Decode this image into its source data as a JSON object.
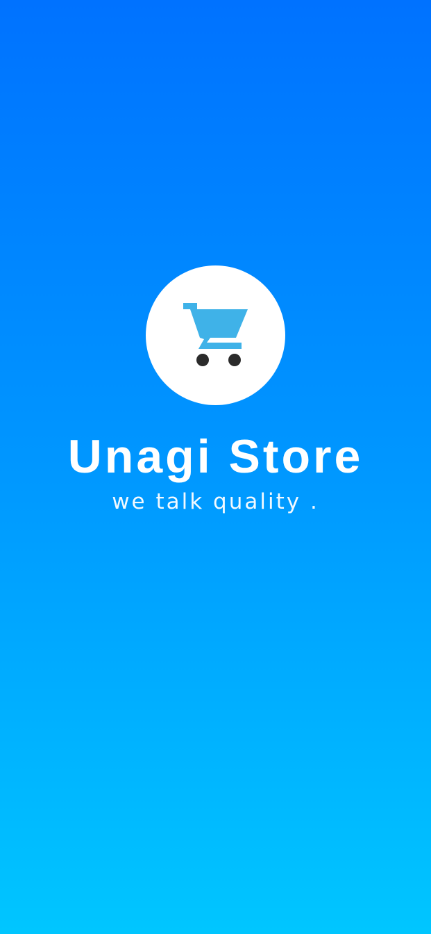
{
  "app": {
    "title": "Unagi Store",
    "tagline": "we talk quality ."
  },
  "logo": {
    "icon": "shopping-cart-icon",
    "cart_color": "#3FB2E8",
    "wheel_color": "#2B2B2B",
    "circle_color": "#FFFFFF"
  },
  "theme": {
    "gradient_top": "#0072FF",
    "gradient_bottom": "#00C6FF",
    "text_color": "#FFFFFF"
  }
}
